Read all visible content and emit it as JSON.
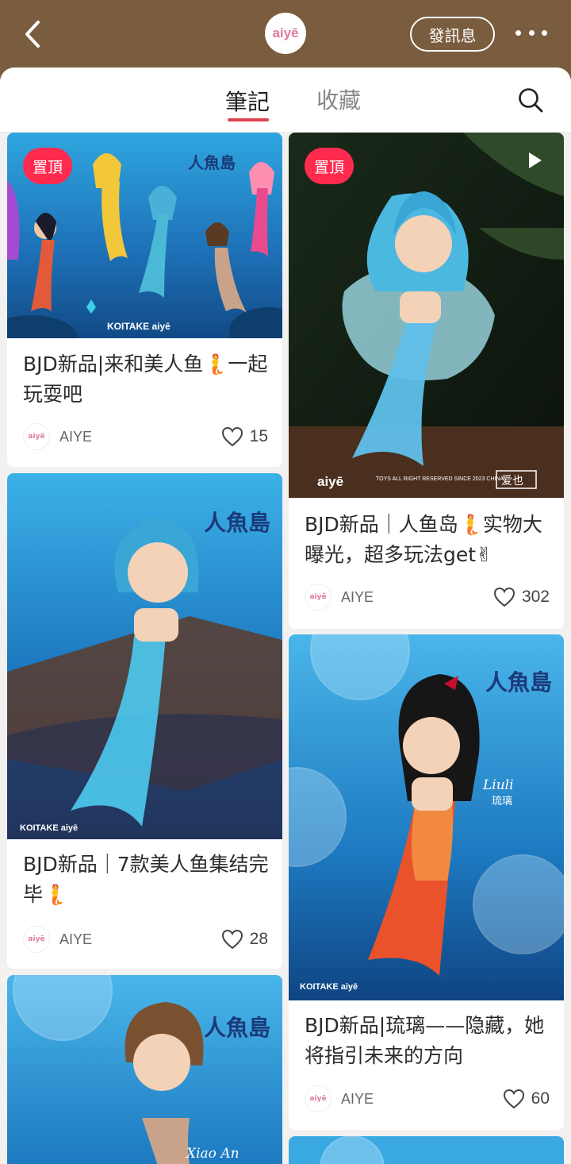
{
  "header": {
    "logo_text": "aiyē",
    "message_button": "發訊息"
  },
  "tabs": [
    {
      "label": "筆記",
      "active": true
    },
    {
      "label": "收藏",
      "active": false
    }
  ],
  "colors": {
    "header_bg": "#7a5c3e",
    "accent": "#e0434f",
    "pin_badge": "#ff2a4e"
  },
  "posts": [
    {
      "title": "BJD新品|来和美人鱼🧜一起玩耍吧",
      "author": "AIYE",
      "likes": "15",
      "pinned_label": "置頂",
      "image_caption": "KOITAKE aiyē",
      "island_title": "人魚島"
    },
    {
      "title": "BJD新品｜人鱼岛🧜实物大曝光，超多玩法get✌",
      "author": "AIYE",
      "likes": "302",
      "pinned_label": "置頂",
      "image_caption": "aiyē",
      "video": true,
      "image_rights": "TOYS ALL RIGHT RESERVED SINCE 2023 CHINA",
      "image_brand": "爱也"
    },
    {
      "title": "BJD新品｜7款美人鱼集结完毕🧜",
      "author": "AIYE",
      "likes": "28",
      "image_caption": "KOITAKE aiyē",
      "island_title": "人魚島"
    },
    {
      "title": "BJD新品|琉璃——隐藏，她将指引未来的方向",
      "author": "AIYE",
      "likes": "60",
      "image_caption": "KOITAKE aiyē",
      "island_title": "人魚島",
      "character_name": "Liuli",
      "character_name_cn": "琉璃"
    },
    {
      "island_title": "人魚島",
      "character_name": "Xiao An"
    }
  ],
  "avatar_text": "aiyē"
}
